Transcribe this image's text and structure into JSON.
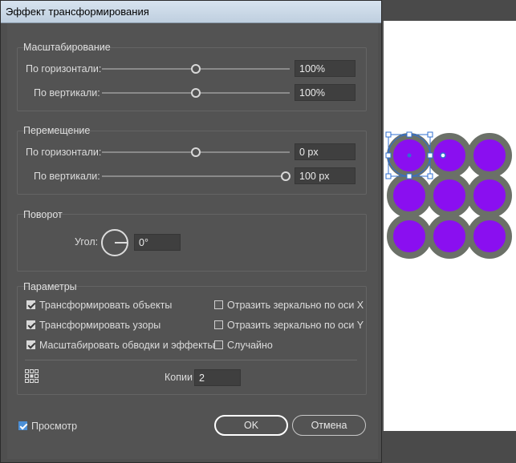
{
  "window": {
    "title": "Эффект трансформирования"
  },
  "scale": {
    "group_title": "Масштабирование",
    "horizontal_label": "По горизонтали:",
    "horizontal_value": "100%",
    "horizontal_slider_fraction": 0.47,
    "vertical_label": "По вертикали:",
    "vertical_value": "100%",
    "vertical_slider_fraction": 0.47
  },
  "move": {
    "group_title": "Перемещение",
    "horizontal_label": "По горизонтали:",
    "horizontal_value": "0 px",
    "horizontal_slider_fraction": 0.5,
    "vertical_label": "По вертикали:",
    "vertical_value": "100 px",
    "vertical_slider_fraction": 1.0
  },
  "rotate": {
    "group_title": "Поворот",
    "angle_label": "Угол:",
    "angle_value": "0°"
  },
  "options": {
    "group_title": "Параметры",
    "transform_objects": {
      "label": "Трансформировать объекты",
      "checked": true
    },
    "transform_patterns": {
      "label": "Трансформировать узоры",
      "checked": true
    },
    "scale_strokes": {
      "label": "Масштабировать обводки и эффекты",
      "checked": true
    },
    "reflect_x": {
      "label": "Отразить зеркально по оси X",
      "checked": false
    },
    "reflect_y": {
      "label": "Отразить зеркально по оси Y",
      "checked": false
    },
    "random": {
      "label": "Случайно",
      "checked": false
    },
    "copies_label": "Копии",
    "copies_value": "2"
  },
  "footer": {
    "preview_label": "Просмотр",
    "preview_checked": true,
    "ok_label": "OK",
    "cancel_label": "Отмена"
  },
  "colors": {
    "circle_fill": "#8a0ff0",
    "circle_stroke": "#6b7068",
    "selection": "#2f6fd0"
  },
  "icons": {
    "reference_point": "reference-point-grid-icon",
    "angle_dial": "angle-dial-icon"
  }
}
